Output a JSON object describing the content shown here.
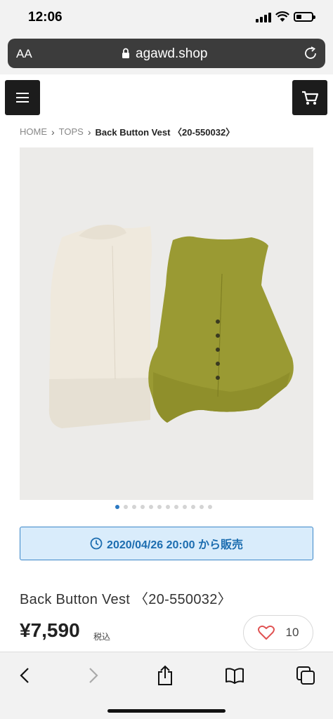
{
  "status": {
    "time": "12:06"
  },
  "browser": {
    "text_size_label": "AA",
    "url": "agawd.shop"
  },
  "breadcrumb": {
    "home": "HOME",
    "category": "TOPS",
    "current": "Back Button Vest 〈20-550032〉"
  },
  "gallery": {
    "total": 12,
    "active": 1
  },
  "sale": {
    "text": "2020/04/26 20:00 から販売"
  },
  "product": {
    "title": "Back Button Vest 〈20-550032〉",
    "price": "¥7,590",
    "tax_label": "税込"
  },
  "likes": {
    "count": "10"
  },
  "colors": {
    "accent": "#2b79c2",
    "banner_bg": "#d9ecfb",
    "header_btn": "#1c1c1c",
    "heart": "#e05252"
  },
  "icons": [
    "menu-icon",
    "cart-icon",
    "lock-icon",
    "reload-icon",
    "clock-icon",
    "heart-icon",
    "back-icon",
    "forward-icon",
    "share-icon",
    "bookmarks-icon",
    "tabs-icon"
  ]
}
